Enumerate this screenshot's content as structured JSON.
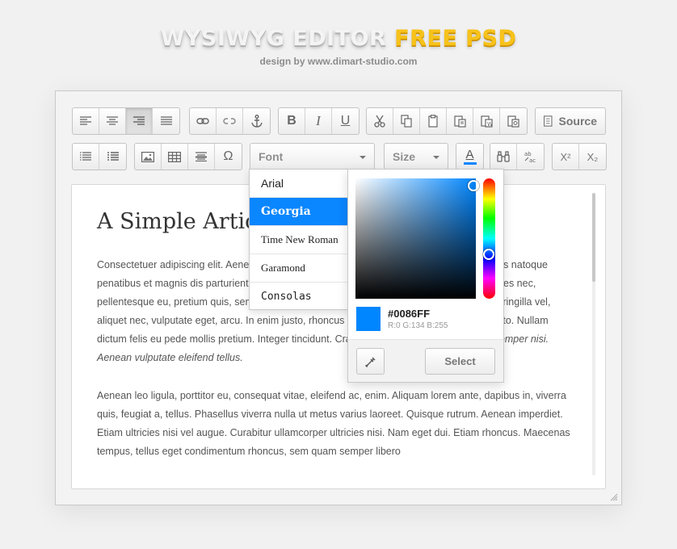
{
  "header": {
    "title_main": "WYSIWYG EDITOR",
    "title_accent": "FREE PSD",
    "subtitle": "design by www.dimart-studio.com"
  },
  "toolbar": {
    "source_label": "Source",
    "font_label": "Font",
    "size_label": "Size",
    "bold_label": "B",
    "italic_label": "I",
    "underline_label": "U",
    "special_char_label": "Ω",
    "text_color_label": "A",
    "superscript_label": "X²",
    "subscript_label": "X₂"
  },
  "font_menu": {
    "items": [
      "Arial",
      "Georgia",
      "Time New Roman",
      "Garamond",
      "Consolas"
    ],
    "selected": "Georgia"
  },
  "color_picker": {
    "hex": "#0086FF",
    "rgb": "R:0 G:134 B:255",
    "select_label": "Select",
    "current_color": "#0086ff"
  },
  "document": {
    "title": "A Simple Article",
    "paragraph1_text": "Consectetuer adipiscing elit. Aenean commodo ligula eget dolor. Aenean massa. Cum sociis natoque penatibus et magnis dis parturient montes, nascetur ridiculus mus. Donec quam felis, ultricies nec, pellentesque eu, pretium quis, sem. Nulla consequat massa quis enim. Donec pede justo, fringilla vel, aliquet nec, vulputate eget, arcu. In enim justo, rhoncus ut, imperdiet a, venenatis vitae, justo. Nullam dictum felis eu pede mollis pretium. Integer tincidunt. Cras dapibus. Vivamus elementum",
    "paragraph1_italic": "semper nisi. Aenean vulputate eleifend tellus.",
    "paragraph2": "Aenean leo ligula, porttitor eu, consequat vitae, eleifend ac, enim. Aliquam lorem ante, dapibus in, viverra quis, feugiat a, tellus. Phasellus viverra nulla ut metus varius laoreet. Quisque rutrum. Aenean imperdiet. Etiam ultricies nisi vel augue. Curabitur ullamcorper ultricies nisi. Nam eget dui. Etiam rhoncus. Maecenas tempus, tellus eget condimentum rhoncus, sem quam semper libero"
  },
  "icons": {
    "align_left": "align-left-icon",
    "align_center": "align-center-icon",
    "align_right": "align-right-icon",
    "align_justify": "align-justify-icon",
    "link": "link-icon",
    "unlink": "unlink-icon",
    "anchor": "anchor-icon",
    "cut": "scissors-icon",
    "copy": "copy-icon",
    "paste": "clipboard-icon",
    "paste_text": "paste-text-icon",
    "paste_word": "paste-word-icon",
    "paste_image": "paste-image-icon",
    "source": "document-icon",
    "bullet_list": "bullet-list-icon",
    "numbered_list": "numbered-list-icon",
    "image": "image-icon",
    "table": "table-icon",
    "horizontal_rule": "horizontal-rule-icon",
    "find": "binoculars-icon",
    "spellcheck": "spellcheck-icon",
    "eyedropper": "eyedropper-icon"
  },
  "colors": {
    "accent_title": "#f7c21b",
    "selection_blue": "#0a86ff"
  }
}
